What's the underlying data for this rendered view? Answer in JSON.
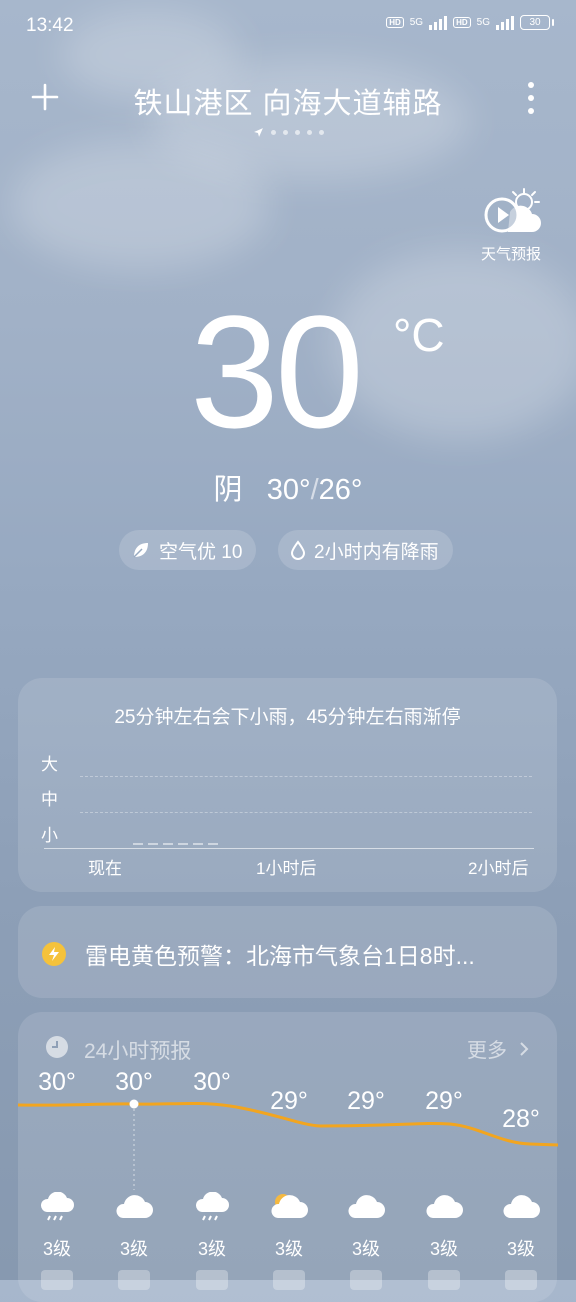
{
  "status_bar": {
    "time": "13:42",
    "sim1_hd": "HD",
    "sim1_net": "5G",
    "sim2_hd": "HD",
    "sim2_net": "5G",
    "battery": "30"
  },
  "header": {
    "add_icon": "plus-icon",
    "city": "铁山港区 向海大道辅路",
    "menu_icon": "more-vertical-icon",
    "location_icon": "location-arrow-icon",
    "page_count": 5
  },
  "forecast_video": {
    "label": "天气预报",
    "icon": "play-sun-cloud-icon"
  },
  "current": {
    "temperature": "30",
    "unit": "°C",
    "condition": "阴",
    "high": "30°",
    "separator": "/",
    "low": "26°"
  },
  "chips": {
    "air_quality": {
      "icon": "leaf-icon",
      "text": "空气优 10"
    },
    "rain_notice": {
      "icon": "raindrop-icon",
      "text": "2小时内有降雨"
    }
  },
  "precip_card": {
    "summary": "25分钟左右会下小雨，45分钟左右雨渐停",
    "y_levels": [
      "大",
      "中",
      "小"
    ],
    "x_labels": [
      "现在",
      "1小时后",
      "2小时后"
    ]
  },
  "alert": {
    "icon": "lightning-icon",
    "text": "雷电黄色预警：北海市气象台1日8时..."
  },
  "hourly": {
    "icon": "clock-icon",
    "title": "24小时预报",
    "more": "更多",
    "more_icon": "chevron-right-icon",
    "line_color": "#f2a51f",
    "items": [
      {
        "temp": "30°",
        "icon": "rain-icon",
        "wind": "3级"
      },
      {
        "temp": "30°",
        "icon": "cloud-icon",
        "wind": "3级"
      },
      {
        "temp": "30°",
        "icon": "rain-icon",
        "wind": "3级"
      },
      {
        "temp": "29°",
        "icon": "partly-cloudy-icon",
        "wind": "3级"
      },
      {
        "temp": "29°",
        "icon": "cloud-icon",
        "wind": "3级"
      },
      {
        "temp": "29°",
        "icon": "cloud-icon",
        "wind": "3级"
      },
      {
        "temp": "28°",
        "icon": "cloud-icon",
        "wind": "3级"
      }
    ]
  }
}
